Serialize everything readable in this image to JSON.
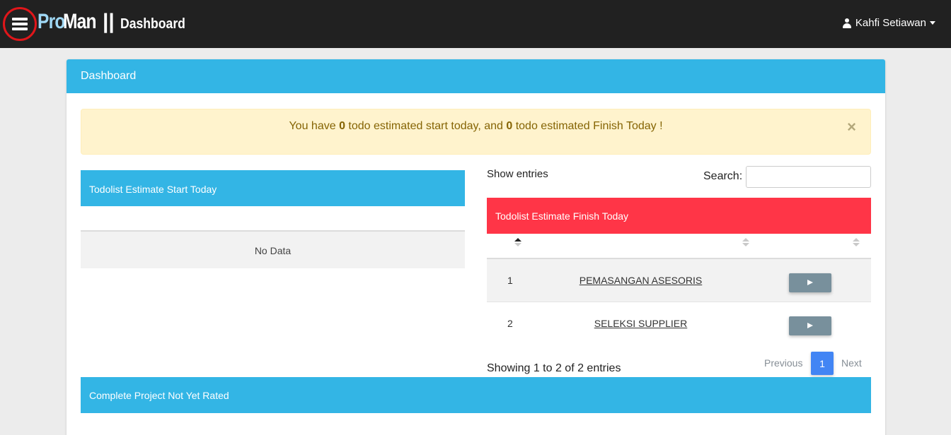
{
  "navbar": {
    "brand_pro": "Pro",
    "brand_man": "Man",
    "brand_sep": "||",
    "page_name": "Dashboard",
    "user_name": "Kahfi Setiawan",
    "menu_icon": "hamburger-icon",
    "user_icon": "user-icon"
  },
  "card": {
    "title": "Dashboard"
  },
  "alert": {
    "pre": "You have ",
    "start_count": "0",
    "mid": " todo estimated start today, and ",
    "finish_count": "0",
    "post": " todo estimated Finish Today !",
    "close": "×"
  },
  "start_today": {
    "title": "Todolist Estimate Start Today",
    "empty_text": "No Data"
  },
  "finish_today": {
    "show_entries": "Show entries",
    "search_label": "Search:",
    "search_value": "",
    "title": "Todolist Estimate Finish Today",
    "rows": [
      {
        "no": "1",
        "name": "PEMASANGAN ASESORIS"
      },
      {
        "no": "2",
        "name": "SELEKSI SUPPLIER"
      }
    ],
    "info": "Showing 1 to 2 of 2 entries",
    "pagination": {
      "previous": "Previous",
      "current": "1",
      "next": "Next"
    }
  },
  "unrated": {
    "title": "Complete Project Not Yet Rated"
  },
  "colors": {
    "navbar": "#212121",
    "info": "#33b5e5",
    "danger": "#ff3547",
    "warning_bg": "#fff3cd",
    "primary": "#4285f4",
    "action_button": "#78909c"
  }
}
